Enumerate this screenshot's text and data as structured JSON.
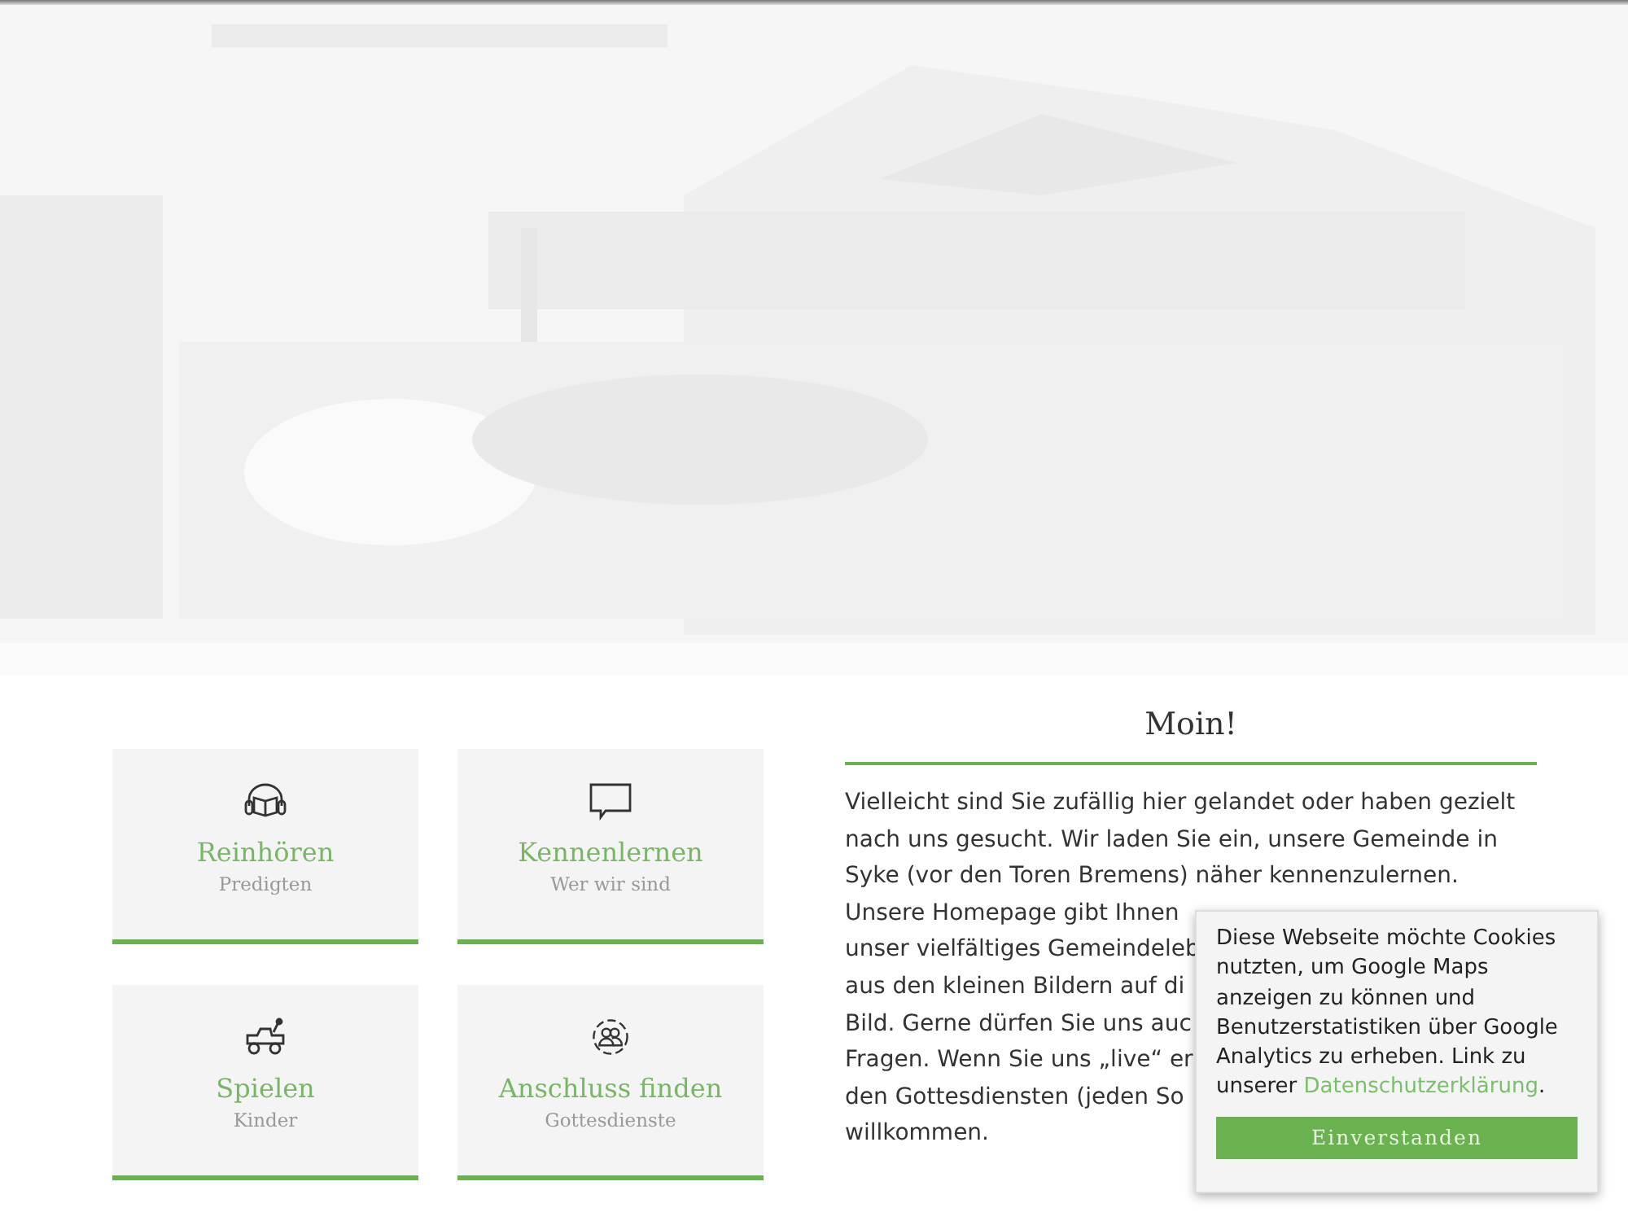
{
  "tiles": [
    {
      "title": "Reinhören",
      "subtitle": "Predigten"
    },
    {
      "title": "Kennenlernen",
      "subtitle": "Wer wir sind"
    },
    {
      "title": "Spielen",
      "subtitle": "Kinder"
    },
    {
      "title": "Anschluss finden",
      "subtitle": "Gottesdienste"
    }
  ],
  "welcome": {
    "heading": "Moin!",
    "lines": [
      "Vielleicht sind Sie zufällig hier gelandet oder haben gezielt",
      "nach uns gesucht. Wir laden Sie ein, unsere Gemeinde in",
      "Syke (vor den Toren Bremens) näher kennenzulernen.",
      "Unsere Homepage gibt Ihnen",
      "unser vielfältiges Gemeindeleb",
      "aus den kleinen Bildern auf di",
      "Bild. Gerne dürfen Sie uns auc",
      "Fragen. Wenn Sie uns „live“ er",
      "den Gottesdiensten (jeden So",
      "willkommen."
    ]
  },
  "cookie_notice": {
    "text": "Diese Webseite möchte Cookies nutzten, um Google Maps anzeigen zu können und Benutzerstatistiken über Google Analytics zu erheben. Link zu unserer ",
    "link": "Datenschutzerklärung",
    "after": ".",
    "button": "Einverstanden"
  }
}
